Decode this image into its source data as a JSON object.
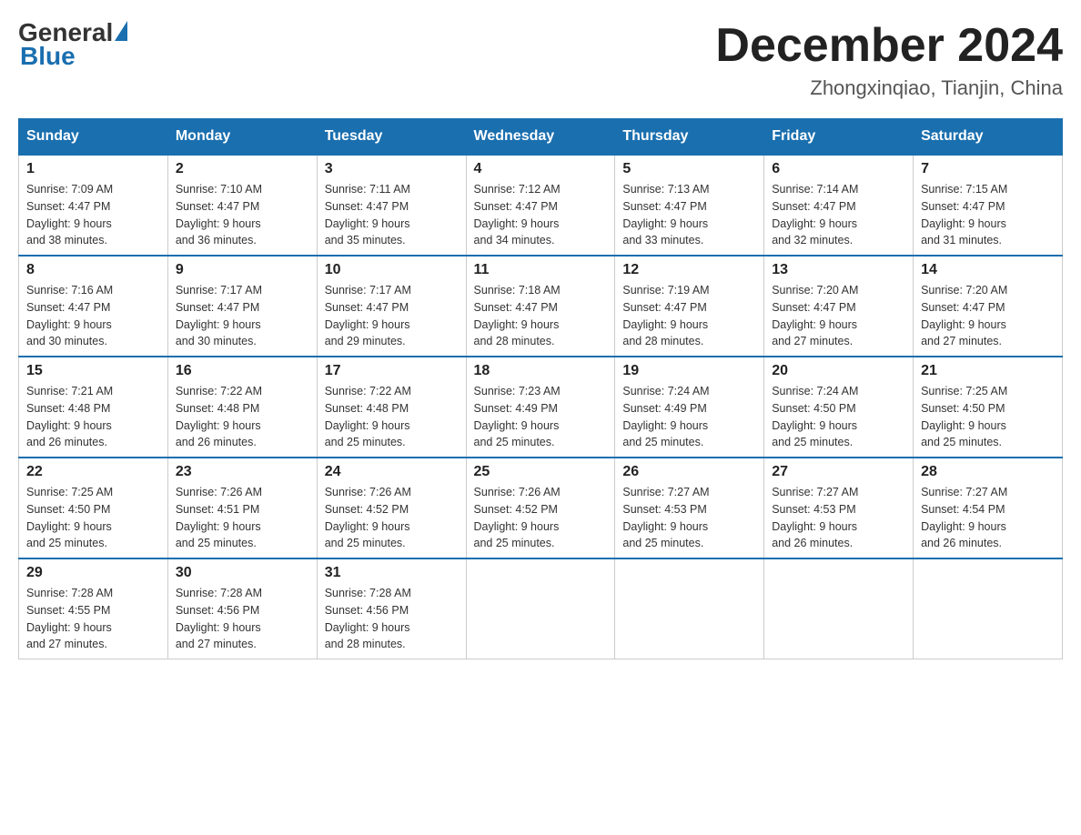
{
  "logo": {
    "general": "General",
    "blue": "Blue"
  },
  "header": {
    "month": "December 2024",
    "location": "Zhongxinqiao, Tianjin, China"
  },
  "weekdays": [
    "Sunday",
    "Monday",
    "Tuesday",
    "Wednesday",
    "Thursday",
    "Friday",
    "Saturday"
  ],
  "weeks": [
    [
      {
        "day": "1",
        "sunrise": "7:09 AM",
        "sunset": "4:47 PM",
        "daylight": "9 hours and 38 minutes."
      },
      {
        "day": "2",
        "sunrise": "7:10 AM",
        "sunset": "4:47 PM",
        "daylight": "9 hours and 36 minutes."
      },
      {
        "day": "3",
        "sunrise": "7:11 AM",
        "sunset": "4:47 PM",
        "daylight": "9 hours and 35 minutes."
      },
      {
        "day": "4",
        "sunrise": "7:12 AM",
        "sunset": "4:47 PM",
        "daylight": "9 hours and 34 minutes."
      },
      {
        "day": "5",
        "sunrise": "7:13 AM",
        "sunset": "4:47 PM",
        "daylight": "9 hours and 33 minutes."
      },
      {
        "day": "6",
        "sunrise": "7:14 AM",
        "sunset": "4:47 PM",
        "daylight": "9 hours and 32 minutes."
      },
      {
        "day": "7",
        "sunrise": "7:15 AM",
        "sunset": "4:47 PM",
        "daylight": "9 hours and 31 minutes."
      }
    ],
    [
      {
        "day": "8",
        "sunrise": "7:16 AM",
        "sunset": "4:47 PM",
        "daylight": "9 hours and 30 minutes."
      },
      {
        "day": "9",
        "sunrise": "7:17 AM",
        "sunset": "4:47 PM",
        "daylight": "9 hours and 30 minutes."
      },
      {
        "day": "10",
        "sunrise": "7:17 AM",
        "sunset": "4:47 PM",
        "daylight": "9 hours and 29 minutes."
      },
      {
        "day": "11",
        "sunrise": "7:18 AM",
        "sunset": "4:47 PM",
        "daylight": "9 hours and 28 minutes."
      },
      {
        "day": "12",
        "sunrise": "7:19 AM",
        "sunset": "4:47 PM",
        "daylight": "9 hours and 28 minutes."
      },
      {
        "day": "13",
        "sunrise": "7:20 AM",
        "sunset": "4:47 PM",
        "daylight": "9 hours and 27 minutes."
      },
      {
        "day": "14",
        "sunrise": "7:20 AM",
        "sunset": "4:47 PM",
        "daylight": "9 hours and 27 minutes."
      }
    ],
    [
      {
        "day": "15",
        "sunrise": "7:21 AM",
        "sunset": "4:48 PM",
        "daylight": "9 hours and 26 minutes."
      },
      {
        "day": "16",
        "sunrise": "7:22 AM",
        "sunset": "4:48 PM",
        "daylight": "9 hours and 26 minutes."
      },
      {
        "day": "17",
        "sunrise": "7:22 AM",
        "sunset": "4:48 PM",
        "daylight": "9 hours and 25 minutes."
      },
      {
        "day": "18",
        "sunrise": "7:23 AM",
        "sunset": "4:49 PM",
        "daylight": "9 hours and 25 minutes."
      },
      {
        "day": "19",
        "sunrise": "7:24 AM",
        "sunset": "4:49 PM",
        "daylight": "9 hours and 25 minutes."
      },
      {
        "day": "20",
        "sunrise": "7:24 AM",
        "sunset": "4:50 PM",
        "daylight": "9 hours and 25 minutes."
      },
      {
        "day": "21",
        "sunrise": "7:25 AM",
        "sunset": "4:50 PM",
        "daylight": "9 hours and 25 minutes."
      }
    ],
    [
      {
        "day": "22",
        "sunrise": "7:25 AM",
        "sunset": "4:50 PM",
        "daylight": "9 hours and 25 minutes."
      },
      {
        "day": "23",
        "sunrise": "7:26 AM",
        "sunset": "4:51 PM",
        "daylight": "9 hours and 25 minutes."
      },
      {
        "day": "24",
        "sunrise": "7:26 AM",
        "sunset": "4:52 PM",
        "daylight": "9 hours and 25 minutes."
      },
      {
        "day": "25",
        "sunrise": "7:26 AM",
        "sunset": "4:52 PM",
        "daylight": "9 hours and 25 minutes."
      },
      {
        "day": "26",
        "sunrise": "7:27 AM",
        "sunset": "4:53 PM",
        "daylight": "9 hours and 25 minutes."
      },
      {
        "day": "27",
        "sunrise": "7:27 AM",
        "sunset": "4:53 PM",
        "daylight": "9 hours and 26 minutes."
      },
      {
        "day": "28",
        "sunrise": "7:27 AM",
        "sunset": "4:54 PM",
        "daylight": "9 hours and 26 minutes."
      }
    ],
    [
      {
        "day": "29",
        "sunrise": "7:28 AM",
        "sunset": "4:55 PM",
        "daylight": "9 hours and 27 minutes."
      },
      {
        "day": "30",
        "sunrise": "7:28 AM",
        "sunset": "4:56 PM",
        "daylight": "9 hours and 27 minutes."
      },
      {
        "day": "31",
        "sunrise": "7:28 AM",
        "sunset": "4:56 PM",
        "daylight": "9 hours and 28 minutes."
      },
      null,
      null,
      null,
      null
    ]
  ]
}
